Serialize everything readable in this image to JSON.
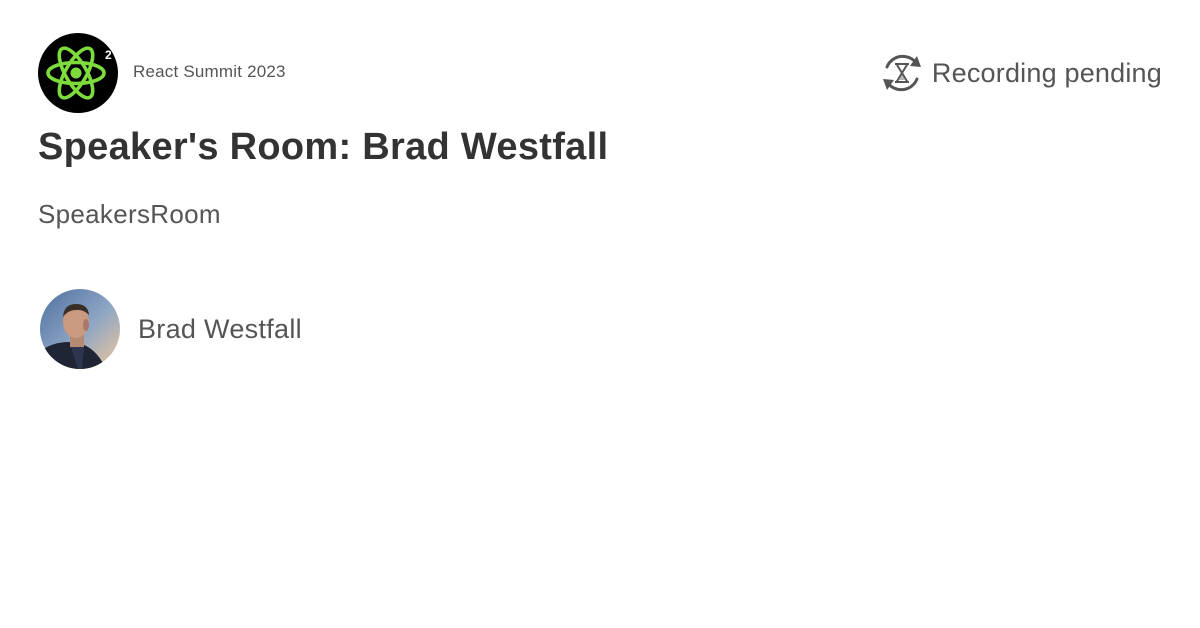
{
  "header": {
    "event_name": "React Summit 2023",
    "event_logo_icon": "react-atom-logo-icon",
    "event_logo_badge": "2",
    "recording_icon": "recording-pending-icon",
    "recording_status": "Recording pending"
  },
  "talk": {
    "title": "Speaker's Room: Brad Westfall",
    "tag": "SpeakersRoom"
  },
  "speaker": {
    "name": "Brad Westfall"
  },
  "colors": {
    "background": "#ffffff",
    "title_text": "#333333",
    "body_text": "#555555",
    "logo_green": "#7ddc3c"
  }
}
